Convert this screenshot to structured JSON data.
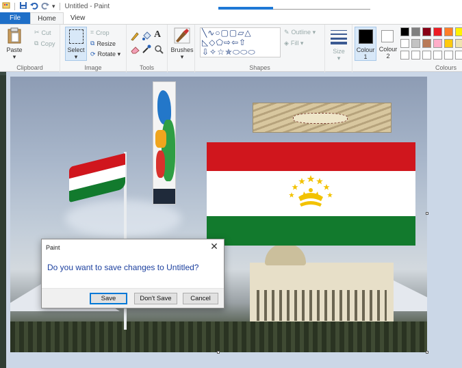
{
  "window": {
    "title": "Untitled - Paint",
    "quick_access_arrow": "▾"
  },
  "tabs": [
    {
      "label": "File"
    },
    {
      "label": "Home"
    },
    {
      "label": "View"
    }
  ],
  "ribbon": {
    "clipboard": {
      "paste": "Paste",
      "cut": "Cut",
      "copy": "Copy",
      "group": "Clipboard"
    },
    "image": {
      "select": "Select",
      "crop": "Crop",
      "resize": "Resize",
      "rotate": "Rotate ▾",
      "group": "Image"
    },
    "tools": {
      "group": "Tools"
    },
    "brushes": {
      "label": "Brushes"
    },
    "shapes": {
      "row1": "╲∿○▢▢▱△",
      "row2": "◺◇⬠⇨⇦⇧",
      "row3": "⇩✧☆✯⬭⬭⬭",
      "outline": "Outline ▾",
      "fill": "Fill ▾",
      "group": "Shapes"
    },
    "size": {
      "label": "Size"
    },
    "colours": {
      "colour1": "Colour",
      "colour1_num": "1",
      "colour2": "Colour",
      "colour2_num": "2",
      "group": "Colours"
    }
  },
  "palette": [
    "#000000",
    "#7f7f7f",
    "#880015",
    "#ed1c24",
    "#ff7f27",
    "#fff200",
    "#ffffff",
    "#c3c3c3",
    "#b97a57",
    "#ffaec9",
    "#ffc90e",
    "#efe4b0",
    "#ffffff",
    "#ffffff",
    "#ffffff",
    "#ffffff",
    "#ffffff",
    "#ffffff"
  ],
  "dialog": {
    "title": "Paint",
    "close": "✕",
    "message": "Do you want to save changes to Untitled?",
    "buttons": {
      "save": "Save",
      "dont_save": "Don't Save",
      "cancel": "Cancel"
    }
  }
}
